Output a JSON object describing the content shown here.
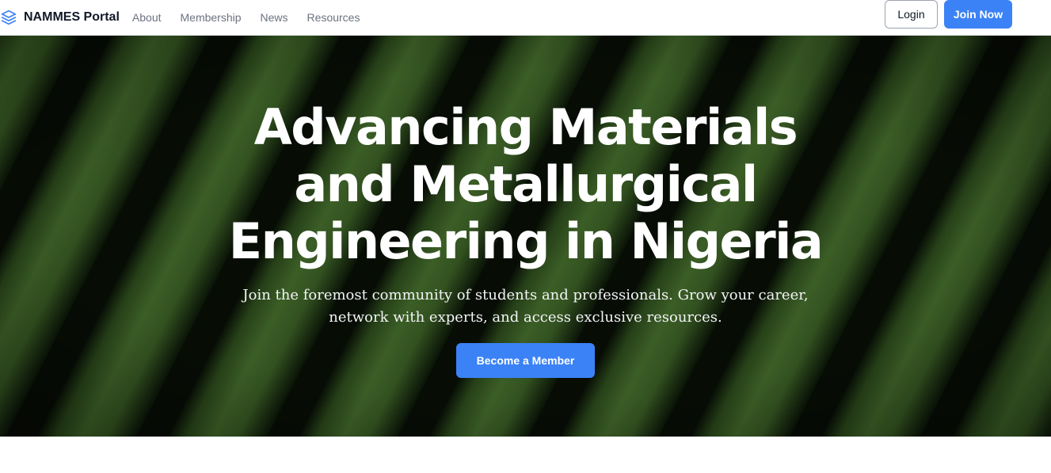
{
  "header": {
    "brand": {
      "icon": "layers-icon",
      "name": "NAMMES Portal"
    },
    "nav": [
      {
        "label": "About"
      },
      {
        "label": "Membership"
      },
      {
        "label": "News"
      },
      {
        "label": "Resources"
      }
    ],
    "login_label": "Login",
    "join_label": "Join Now"
  },
  "hero": {
    "title": "Advancing Materials and Metallurgical Engineering in Nigeria",
    "subtitle": "Join the foremost community of students and professionals. Grow your career, network with experts, and access exclusive resources.",
    "cta_label": "Become a Member",
    "background": "green-metal-ribs-photo"
  },
  "colors": {
    "accent": "#3b82f6",
    "hero_green": "#3a5a26",
    "hero_dark": "#0b1408",
    "nav_text": "#6b7280"
  }
}
